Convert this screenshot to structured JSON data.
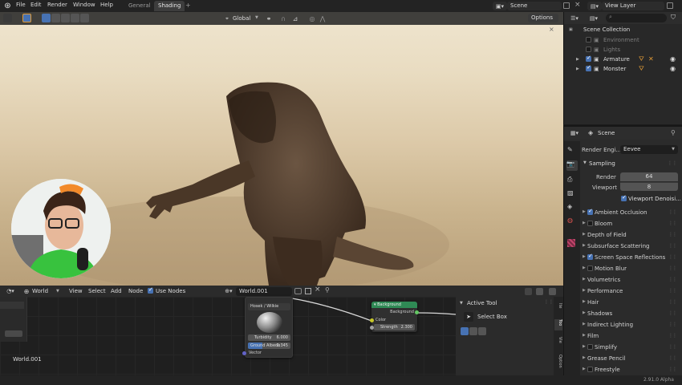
{
  "topbar": {
    "menu": [
      "File",
      "Edit",
      "Render",
      "Window",
      "Help"
    ],
    "workspace_tabs": [
      "General",
      "Shading"
    ],
    "add_tab": "+",
    "scene_name": "Scene",
    "view_layer": "View Layer"
  },
  "viewport_header": {
    "orientation": "Global",
    "options": "Options"
  },
  "outliner": {
    "collection": "Scene Collection",
    "items": [
      {
        "label": "Environment",
        "checked": false,
        "dimmed": true
      },
      {
        "label": "Lights",
        "checked": false,
        "dimmed": true
      },
      {
        "label": "Armature",
        "checked": true,
        "dimmed": false
      },
      {
        "label": "Monster",
        "checked": true,
        "dimmed": false
      }
    ]
  },
  "properties": {
    "scene": "Scene",
    "render_engine_label": "Render Engi...",
    "render_engine_value": "Eevee",
    "sampling": "Sampling",
    "render_label": "Render",
    "render_value": "64",
    "viewport_label": "Viewport",
    "viewport_value": "8",
    "viewport_denoise": "Viewport Denoisi...",
    "panels": [
      {
        "label": "Ambient Occlusion",
        "check": true
      },
      {
        "label": "Bloom",
        "check": false
      },
      {
        "label": "Depth of Field",
        "check": null
      },
      {
        "label": "Subsurface Scattering",
        "check": null
      },
      {
        "label": "Screen Space Reflections",
        "check": true
      },
      {
        "label": "Motion Blur",
        "check": false
      },
      {
        "label": "Volumetrics",
        "check": null
      },
      {
        "label": "Performance",
        "check": null
      },
      {
        "label": "Hair",
        "check": null
      },
      {
        "label": "Shadows",
        "check": null
      },
      {
        "label": "Indirect Lighting",
        "check": null
      },
      {
        "label": "Film",
        "check": null
      },
      {
        "label": "Simplify",
        "check": false
      },
      {
        "label": "Grease Pencil",
        "check": null
      },
      {
        "label": "Freestyle",
        "check": false
      }
    ]
  },
  "node_editor": {
    "world_type": "World",
    "menu": [
      "View",
      "Select",
      "Add",
      "Node"
    ],
    "use_nodes": "Use Nodes",
    "world_name": "World.001",
    "footer_world": "World.001",
    "sky_node": {
      "type": "Hosek / Wilkie",
      "turbidity_label": "Turbidity",
      "turbidity_value": "6.000",
      "albedo_label": "Ground Albedo",
      "albedo_value": "0.345",
      "vector": "Vector"
    },
    "bg_node": {
      "title": "Background",
      "output": "Background",
      "color": "Color",
      "strength_label": "Strength",
      "strength_value": "2.300"
    }
  },
  "tool_panel": {
    "title": "Active Tool",
    "tool": "Select Box",
    "tabs": [
      "Ite",
      "Too",
      "Vie",
      "Option"
    ]
  },
  "status": {
    "version": "2.91.0 Alpha"
  },
  "colors": {
    "accent": "#4772b3",
    "background_node": "#2f8a55",
    "object_orange": "#e09a36"
  }
}
